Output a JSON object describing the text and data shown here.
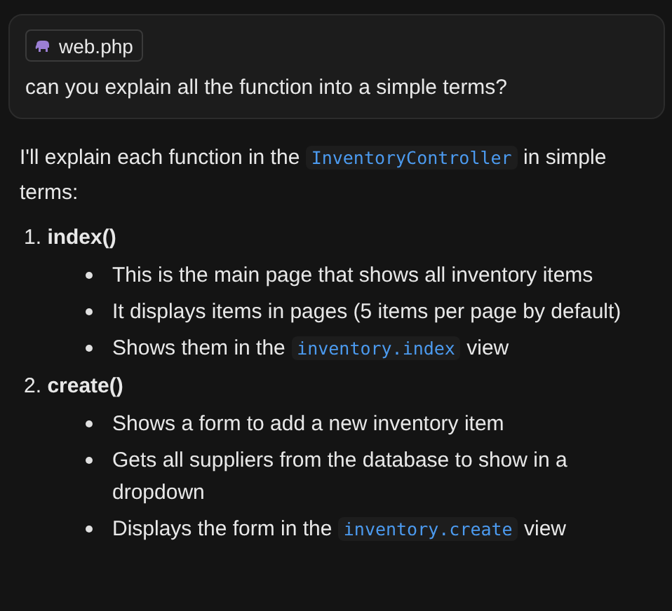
{
  "user_message": {
    "attachment": "web.php",
    "text": "can you explain all the function into a simple terms?"
  },
  "response": {
    "intro": [
      {
        "kind": "text",
        "text": "I'll explain each function in the "
      },
      {
        "kind": "code",
        "text": "InventoryController"
      },
      {
        "kind": "text",
        "text": " in simple terms:"
      }
    ],
    "sections": [
      {
        "number": "1.",
        "title": "index()",
        "bullets": [
          [
            {
              "kind": "text",
              "text": "This is the main page that shows all inventory items"
            }
          ],
          [
            {
              "kind": "text",
              "text": "It displays items in pages (5 items per page by default)"
            }
          ],
          [
            {
              "kind": "text",
              "text": "Shows them in the "
            },
            {
              "kind": "code",
              "text": "inventory.index"
            },
            {
              "kind": "text",
              "text": " view"
            }
          ]
        ]
      },
      {
        "number": "2.",
        "title": "create()",
        "bullets": [
          [
            {
              "kind": "text",
              "text": "Shows a form to add a new inventory item"
            }
          ],
          [
            {
              "kind": "text",
              "text": "Gets all suppliers from the database to show in a dropdown"
            }
          ],
          [
            {
              "kind": "text",
              "text": "Displays the form in the "
            },
            {
              "kind": "code",
              "text": "inventory.create"
            },
            {
              "kind": "text",
              "text": " view"
            }
          ]
        ]
      }
    ]
  }
}
